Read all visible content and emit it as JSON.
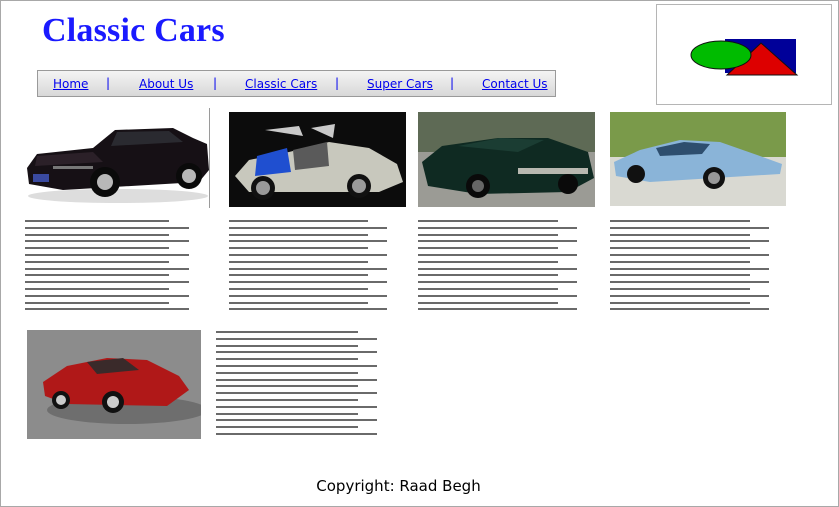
{
  "header": {
    "title": "Classic Cars"
  },
  "logo": {
    "icon": "geometric-logo-icon",
    "colors": [
      "#00cc00",
      "#cc0000",
      "#000099"
    ]
  },
  "nav": {
    "items": [
      {
        "label": "Home"
      },
      {
        "label": "About Us"
      },
      {
        "label": "Classic Cars"
      },
      {
        "label": "Super Cars"
      },
      {
        "label": "Contact Us"
      }
    ],
    "separator": "|"
  },
  "gallery": [
    {
      "icon": "black-muscle-car-image"
    },
    {
      "icon": "silver-gullwing-car-image"
    },
    {
      "icon": "dark-green-charger-car-image"
    },
    {
      "icon": "light-blue-gt-car-image"
    },
    {
      "icon": "red-sports-car-image"
    }
  ],
  "footer": {
    "copyright": "Copyright: Raad Begh"
  }
}
